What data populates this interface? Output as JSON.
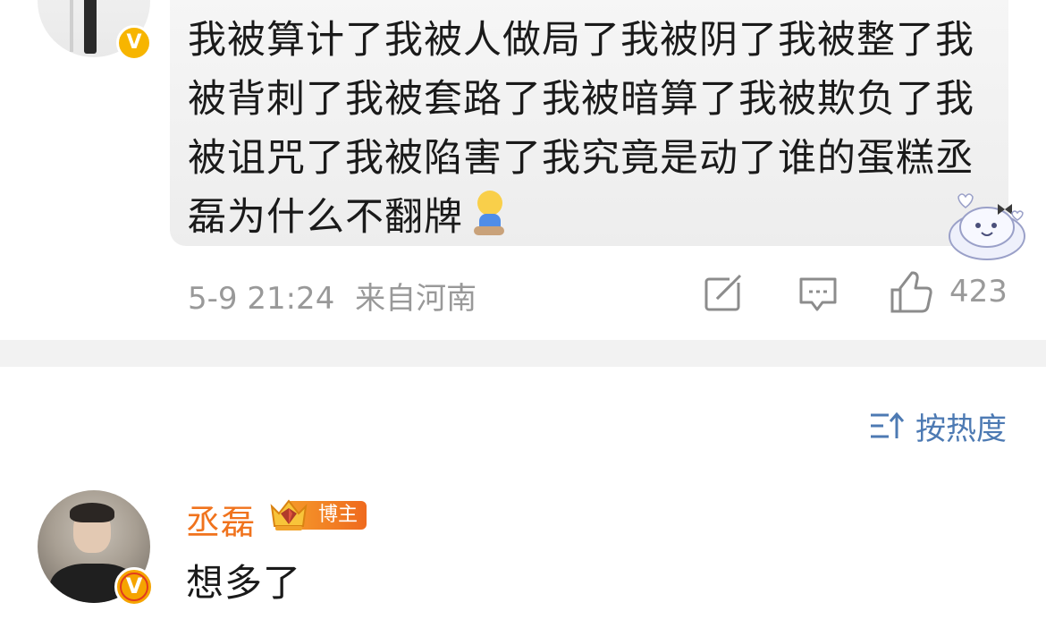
{
  "post": {
    "text": "我被算计了我被人做局了我被阴了我被整了我被背刺了我被套路了我被暗算了我被欺负了我被诅咒了我被陷害了我究竟是动了谁的蛋糕丞磊为什么不翻牌",
    "emoji_icon": "kneeling-person-emoji-icon",
    "timestamp": "5-9 21:24",
    "location": "来自河南",
    "like_count": "423",
    "verified_badge": "V"
  },
  "sort": {
    "label": "按热度",
    "icon": "sort-icon"
  },
  "reply": {
    "author": "丞磊",
    "badge_label": "博主",
    "text": "想多了",
    "verified_badge": "V"
  },
  "colors": {
    "accent_blue": "#4d7ab3",
    "name_orange": "#f0731d",
    "verified_gold": "#f7b500",
    "meta_gray": "#999999"
  }
}
